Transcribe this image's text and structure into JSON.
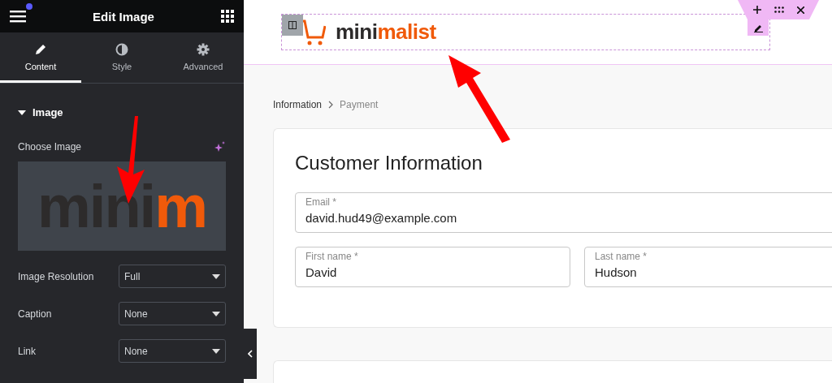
{
  "panel": {
    "title": "Edit Image",
    "tabs": [
      {
        "label": "Content",
        "selected": true
      },
      {
        "label": "Style",
        "selected": false
      },
      {
        "label": "Advanced",
        "selected": false
      }
    ],
    "section": {
      "title": "Image",
      "expanded": true
    },
    "choose_image_label": "Choose Image",
    "image_preview": {
      "text_dark": "mini",
      "text_accent": "m"
    },
    "settings": [
      {
        "label": "Image Resolution",
        "value": "Full"
      },
      {
        "label": "Caption",
        "value": "None"
      },
      {
        "label": "Link",
        "value": "None"
      }
    ]
  },
  "logo": {
    "text_dark": "mini",
    "text_accent": "malist"
  },
  "breadcrumb": [
    {
      "label": "Information",
      "selected": true
    },
    {
      "label": "Payment",
      "selected": false
    }
  ],
  "card": {
    "title": "Customer Information",
    "fields": [
      {
        "label": "Email *",
        "value": "david.hud49@example.com"
      },
      {
        "label": "First name *",
        "value": "David"
      },
      {
        "label": "Last name *",
        "value": "Hudson"
      }
    ]
  }
}
